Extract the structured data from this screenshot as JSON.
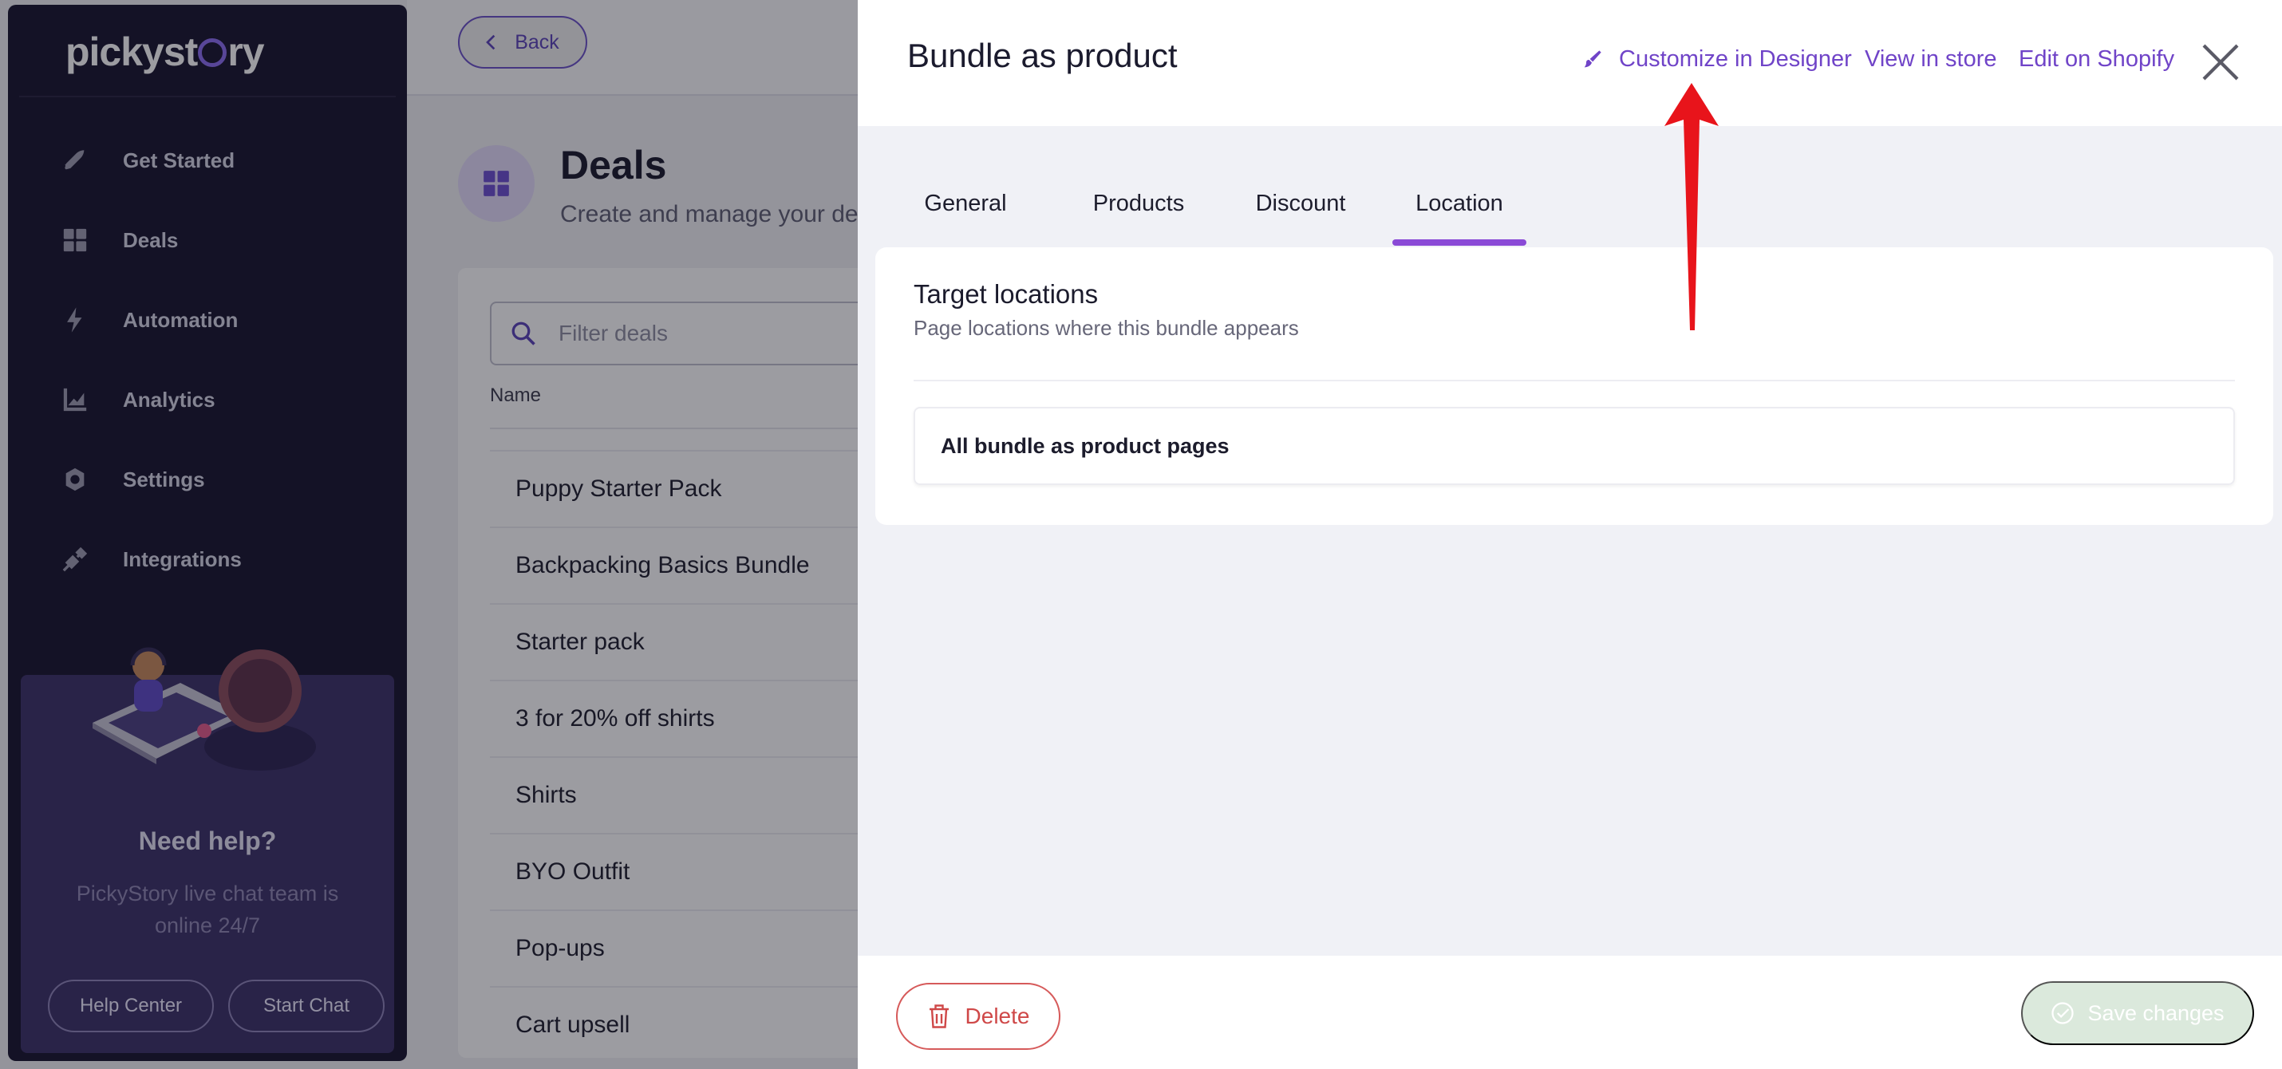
{
  "sidebar": {
    "logo_text": "pickystory",
    "items": [
      {
        "label": "Get Started",
        "icon": "rocket-icon"
      },
      {
        "label": "Deals",
        "icon": "grid-icon"
      },
      {
        "label": "Automation",
        "icon": "bolt-icon"
      },
      {
        "label": "Analytics",
        "icon": "chart-icon"
      },
      {
        "label": "Settings",
        "icon": "gear-icon"
      },
      {
        "label": "Integrations",
        "icon": "plug-icon"
      }
    ],
    "help": {
      "title": "Need help?",
      "subtitle": "PickyStory live chat team is online 24/7",
      "help_center": "Help Center",
      "start_chat": "Start Chat"
    }
  },
  "main": {
    "back_label": "Back",
    "title": "Deals",
    "subtitle": "Create and manage your dea",
    "filter_placeholder": "Filter deals",
    "column_name": "Name",
    "deals": [
      "Puppy Starter Pack",
      "Backpacking Basics Bundle",
      "Starter pack",
      "3 for 20% off shirts",
      "Shirts",
      "BYO Outfit",
      "Pop-ups",
      "Cart upsell"
    ]
  },
  "drawer": {
    "title": "Bundle as product",
    "links": {
      "customize": "Customize in Designer",
      "view_store": "View in store",
      "edit_shopify": "Edit on Shopify"
    },
    "tabs": [
      "General",
      "Products",
      "Discount",
      "Location"
    ],
    "active_tab": "Location",
    "section": {
      "title": "Target locations",
      "subtitle": "Page locations where this bundle appears",
      "item": "All bundle as product pages"
    },
    "footer": {
      "delete": "Delete",
      "save": "Save changes"
    }
  },
  "colors": {
    "accent": "#7044c8",
    "sidebar_bg": "#15122b",
    "danger": "#cf4848",
    "save_disabled": "#dbe9dc",
    "annotation_arrow": "#e8141b"
  }
}
